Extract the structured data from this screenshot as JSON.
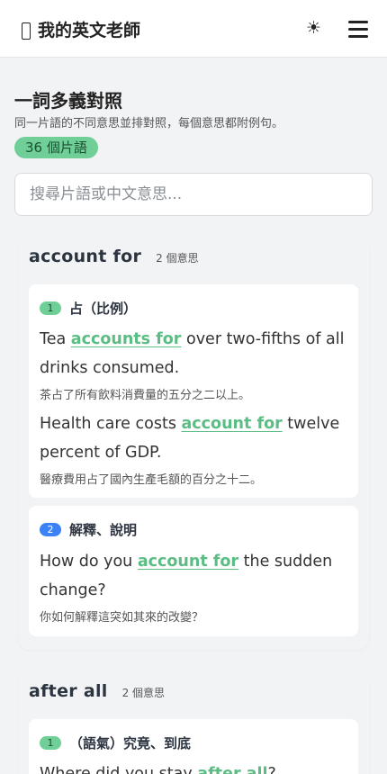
{
  "header": {
    "title": "我的英文老師",
    "theme_icon": "☀"
  },
  "page": {
    "title": "一詞多義對照",
    "subtitle": "同一片語的不同意思並排對照，每個意思都附例句。",
    "count_badge": "36 個片語"
  },
  "search": {
    "placeholder": "搜尋片語或中文意思..."
  },
  "colors": {
    "accent_green": "#6fcf97",
    "highlight_green": "#5cbd84",
    "accent_blue": "#3b82f6"
  },
  "phrases": [
    {
      "phrase": "account for",
      "sense_count": "2 個意思",
      "senses": [
        {
          "num": "1",
          "label": "占（比例）",
          "examples": [
            {
              "pre": "Tea ",
              "hl": "accounts for",
              "post": " over two-fifths of all drinks consumed.",
              "zh": "茶占了所有飲料消費量的五分之二以上。"
            },
            {
              "pre": "Health care costs ",
              "hl": "account for",
              "post": " twelve percent of GDP.",
              "zh": "醫療費用占了國內生產毛額的百分之十二。"
            }
          ]
        },
        {
          "num": "2",
          "label": "解釋、說明",
          "examples": [
            {
              "pre": "How do you ",
              "hl": "account for",
              "post": " the sudden change?",
              "zh": "你如何解釋這突如其來的改變？"
            }
          ]
        }
      ]
    },
    {
      "phrase": "after all",
      "sense_count": "2 個意思",
      "senses": [
        {
          "num": "1",
          "label": "（語氣）究竟、到底",
          "examples": [
            {
              "pre": "Where did you stay ",
              "hl": "after all",
              "post": "?"
            }
          ]
        }
      ]
    }
  ]
}
